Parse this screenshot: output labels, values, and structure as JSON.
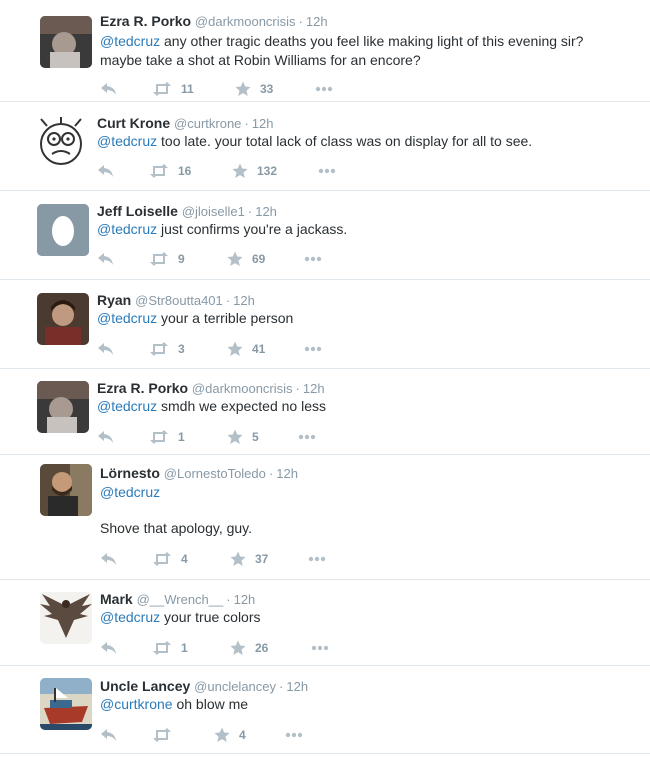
{
  "tweets": [
    {
      "name": "Ezra R. Porko",
      "handle": "@darkmooncrisis",
      "time": "12h",
      "mention": "@tedcruz",
      "line1": " any other tragic deaths you feel like making light of this evening sir?",
      "line2": "maybe take a shot at Robin Williams for an encore?",
      "retweets": "11",
      "favorites": "33",
      "avatar": "photo-dark"
    },
    {
      "name": "Curt Krone",
      "handle": "@curtkrone",
      "time": "12h",
      "mention": "@tedcruz",
      "line1": " too late. your total lack of class was on display for all to see.",
      "retweets": "16",
      "favorites": "132",
      "avatar": "face-drawing"
    },
    {
      "name": "Jeff Loiselle",
      "handle": "@jloiselle1",
      "time": "12h",
      "mention": "@tedcruz",
      "line1": " just confirms you're a jackass.",
      "retweets": "9",
      "favorites": "69",
      "avatar": "egg"
    },
    {
      "name": "Ryan",
      "handle": "@Str8outta401",
      "time": "12h",
      "mention": "@tedcruz",
      "line1": " your a terrible person",
      "retweets": "3",
      "favorites": "41",
      "avatar": "photo-person"
    },
    {
      "name": "Ezra R. Porko",
      "handle": "@darkmooncrisis",
      "time": "12h",
      "mention": "@tedcruz",
      "line1": " smdh we expected no less",
      "retweets": "1",
      "favorites": "5",
      "avatar": "photo-dark"
    },
    {
      "name": "Lörnesto",
      "handle": "@LornestoToledo",
      "time": "12h",
      "mention": "@tedcruz",
      "line1": "",
      "line3": "Shove that apology, guy.",
      "retweets": "4",
      "favorites": "37",
      "avatar": "photo-man"
    },
    {
      "name": "Mark",
      "handle": "@__Wrench__",
      "time": "12h",
      "mention": "@tedcruz",
      "line1": " your true colors",
      "retweets": "1",
      "favorites": "26",
      "avatar": "phoenix"
    },
    {
      "name": "Uncle Lancey",
      "handle": "@unclelancey",
      "time": "12h",
      "mention": "@curtkrone",
      "line1": " oh blow me",
      "retweets": "",
      "favorites": "4",
      "avatar": "boat"
    }
  ],
  "dot": "·",
  "icons": {
    "reply": "reply-icon",
    "retweet": "retweet-icon",
    "favorite": "star-icon",
    "more": "more-icon"
  },
  "colors": {
    "link": "#2b7bb9",
    "muted": "#8899a6",
    "divider": "#e1e8ed"
  }
}
